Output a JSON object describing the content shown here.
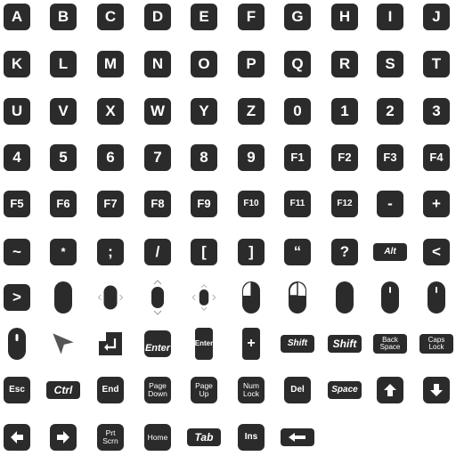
{
  "keys": [
    {
      "name": "key-a",
      "label": "A",
      "type": "sq"
    },
    {
      "name": "key-b",
      "label": "B",
      "type": "sq"
    },
    {
      "name": "key-c",
      "label": "C",
      "type": "sq"
    },
    {
      "name": "key-d",
      "label": "D",
      "type": "sq"
    },
    {
      "name": "key-e",
      "label": "E",
      "type": "sq"
    },
    {
      "name": "key-f",
      "label": "F",
      "type": "sq"
    },
    {
      "name": "key-g",
      "label": "G",
      "type": "sq"
    },
    {
      "name": "key-h",
      "label": "H",
      "type": "sq"
    },
    {
      "name": "key-i",
      "label": "I",
      "type": "sq"
    },
    {
      "name": "key-j",
      "label": "J",
      "type": "sq"
    },
    {
      "name": "key-k",
      "label": "K",
      "type": "sq"
    },
    {
      "name": "key-l",
      "label": "L",
      "type": "sq"
    },
    {
      "name": "key-m",
      "label": "M",
      "type": "sq"
    },
    {
      "name": "key-n",
      "label": "N",
      "type": "sq"
    },
    {
      "name": "key-o",
      "label": "O",
      "type": "sq"
    },
    {
      "name": "key-p",
      "label": "P",
      "type": "sq"
    },
    {
      "name": "key-q",
      "label": "Q",
      "type": "sq"
    },
    {
      "name": "key-r",
      "label": "R",
      "type": "sq"
    },
    {
      "name": "key-s",
      "label": "S",
      "type": "sq"
    },
    {
      "name": "key-t",
      "label": "T",
      "type": "sq"
    },
    {
      "name": "key-u",
      "label": "U",
      "type": "sq"
    },
    {
      "name": "key-v",
      "label": "V",
      "type": "sq"
    },
    {
      "name": "key-x",
      "label": "X",
      "type": "sq"
    },
    {
      "name": "key-w",
      "label": "W",
      "type": "sq"
    },
    {
      "name": "key-y",
      "label": "Y",
      "type": "sq"
    },
    {
      "name": "key-z",
      "label": "Z",
      "type": "sq"
    },
    {
      "name": "key-0",
      "label": "0",
      "type": "sq"
    },
    {
      "name": "key-1",
      "label": "1",
      "type": "sq"
    },
    {
      "name": "key-2",
      "label": "2",
      "type": "sq"
    },
    {
      "name": "key-3",
      "label": "3",
      "type": "sq"
    },
    {
      "name": "key-4",
      "label": "4",
      "type": "sq"
    },
    {
      "name": "key-5",
      "label": "5",
      "type": "sq"
    },
    {
      "name": "key-6",
      "label": "6",
      "type": "sq"
    },
    {
      "name": "key-7",
      "label": "7",
      "type": "sq"
    },
    {
      "name": "key-8",
      "label": "8",
      "type": "sq"
    },
    {
      "name": "key-9",
      "label": "9",
      "type": "sq"
    },
    {
      "name": "key-f1",
      "label": "F1",
      "type": "sq mid"
    },
    {
      "name": "key-f2",
      "label": "F2",
      "type": "sq mid"
    },
    {
      "name": "key-f3",
      "label": "F3",
      "type": "sq mid"
    },
    {
      "name": "key-f4",
      "label": "F4",
      "type": "sq mid"
    },
    {
      "name": "key-f5",
      "label": "F5",
      "type": "sq mid"
    },
    {
      "name": "key-f6",
      "label": "F6",
      "type": "sq mid"
    },
    {
      "name": "key-f7",
      "label": "F7",
      "type": "sq mid"
    },
    {
      "name": "key-f8",
      "label": "F8",
      "type": "sq mid"
    },
    {
      "name": "key-f9",
      "label": "F9",
      "type": "sq mid"
    },
    {
      "name": "key-f10",
      "label": "F10",
      "type": "sq small"
    },
    {
      "name": "key-f11",
      "label": "F11",
      "type": "sq small"
    },
    {
      "name": "key-f12",
      "label": "F12",
      "type": "sq small"
    },
    {
      "name": "key-minus",
      "label": "-",
      "type": "sq"
    },
    {
      "name": "key-plus",
      "label": "+",
      "type": "sq"
    },
    {
      "name": "key-tilde",
      "label": "~",
      "type": "sq"
    },
    {
      "name": "key-asterisk",
      "label": "*",
      "type": "sq mid"
    },
    {
      "name": "key-semicolon",
      "label": ";",
      "type": "sq"
    },
    {
      "name": "key-slash",
      "label": "/",
      "type": "sq"
    },
    {
      "name": "key-bracket-left",
      "label": "[",
      "type": "sq"
    },
    {
      "name": "key-bracket-right",
      "label": "]",
      "type": "sq"
    },
    {
      "name": "key-quote",
      "label": "“",
      "type": "sq"
    },
    {
      "name": "key-question",
      "label": "?",
      "type": "sq"
    },
    {
      "name": "key-alt",
      "label": "Alt",
      "type": "wide it"
    },
    {
      "name": "key-less-than",
      "label": "<",
      "type": "sq"
    },
    {
      "name": "key-greater-than",
      "label": ">",
      "type": "sq"
    },
    {
      "name": "mouse-scroll-vertical-icon",
      "icon": "mouse",
      "type": "glyph"
    },
    {
      "name": "mouse-scroll-horizontal-icon",
      "icon": "mouse-h",
      "type": "glyph"
    },
    {
      "name": "mouse-scroll-up-down-icon",
      "icon": "mouse-v",
      "type": "glyph"
    },
    {
      "name": "mouse-move-all-icon",
      "icon": "mouse-all",
      "type": "glyph"
    },
    {
      "name": "mouse-left-click-icon",
      "icon": "mouse-left",
      "type": "glyph"
    },
    {
      "name": "mouse-right-click-icon",
      "icon": "mouse-right",
      "type": "glyph"
    },
    {
      "name": "mouse-icon",
      "icon": "mouse-plain",
      "type": "glyph"
    },
    {
      "name": "mouse-scroll-wheel-icon",
      "icon": "mouse-wheel",
      "type": "glyph"
    },
    {
      "name": "mouse-scroll-wheel-alt-icon",
      "icon": "mouse-wheel",
      "type": "glyph"
    },
    {
      "name": "mouse-middle-icon",
      "icon": "mouse-wheel-dark",
      "type": "glyph"
    },
    {
      "name": "cursor-arrow-icon",
      "icon": "cursor",
      "type": "glyph"
    },
    {
      "name": "key-return-arrow-icon",
      "icon": "return",
      "type": "glyph"
    },
    {
      "name": "key-enter",
      "label": "Enter",
      "type": "enter"
    },
    {
      "name": "key-enter-tall",
      "label": "Enter",
      "type": "tall"
    },
    {
      "name": "key-plus-tall",
      "label": "+",
      "type": "tall big"
    },
    {
      "name": "key-shift-small",
      "label": "Shift",
      "type": "wide it"
    },
    {
      "name": "key-shift",
      "label": "Shift",
      "type": "wide med"
    },
    {
      "name": "key-backspace",
      "label": "Back\nSpace",
      "type": "wide two"
    },
    {
      "name": "key-caps-lock",
      "label": "Caps\nLock",
      "type": "wide two"
    },
    {
      "name": "key-esc",
      "label": "Esc",
      "type": "sq small"
    },
    {
      "name": "key-ctrl",
      "label": "Ctrl",
      "type": "wide med"
    },
    {
      "name": "key-end",
      "label": "End",
      "type": "sq small"
    },
    {
      "name": "key-page-down",
      "label": "Page\nDown",
      "type": "sq tiny"
    },
    {
      "name": "key-page-up",
      "label": "Page\nUp",
      "type": "sq tiny"
    },
    {
      "name": "key-num-lock",
      "label": "Num\nLock",
      "type": "sq tiny"
    },
    {
      "name": "key-del",
      "label": "Del",
      "type": "sq small"
    },
    {
      "name": "key-space",
      "label": "Space",
      "type": "wide it"
    },
    {
      "name": "key-arrow-up-icon",
      "icon": "up",
      "type": "sq"
    },
    {
      "name": "key-arrow-down-icon",
      "icon": "down",
      "type": "sq"
    },
    {
      "name": "key-arrow-left-icon",
      "icon": "left",
      "type": "sq"
    },
    {
      "name": "key-arrow-right-icon",
      "icon": "right",
      "type": "sq"
    },
    {
      "name": "key-print-screen",
      "label": "Prt\nScrn",
      "type": "sq tiny"
    },
    {
      "name": "key-home",
      "label": "Home",
      "type": "sq tiny"
    },
    {
      "name": "key-tab",
      "label": "Tab",
      "type": "wide med"
    },
    {
      "name": "key-ins",
      "label": "Ins",
      "type": "sq small"
    },
    {
      "name": "key-backspace-arrow-icon",
      "icon": "backspace",
      "type": "wide"
    }
  ]
}
